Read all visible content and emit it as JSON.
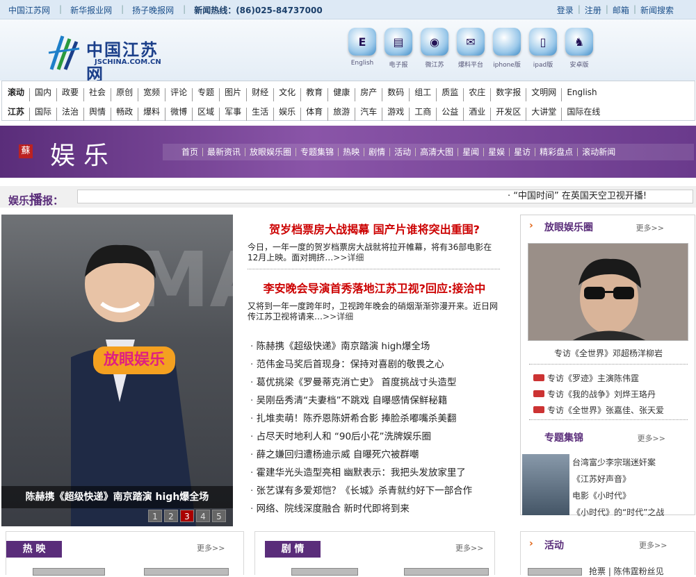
{
  "topbar": {
    "links": [
      "中国江苏网",
      "新华报业网",
      "扬子晚报网"
    ],
    "hotline": "新闻热线：(86)025-84737000",
    "right_links": [
      "登录",
      "注册",
      "邮箱",
      "新闻搜索"
    ]
  },
  "logo": {
    "cn": "中国江苏网",
    "en": "JSCHINA.COM.CN"
  },
  "apps": [
    {
      "icon": "english-app-icon",
      "label": "English",
      "glyph": "E"
    },
    {
      "icon": "epaper-app-icon",
      "label": "电子报",
      "glyph": "▤"
    },
    {
      "icon": "weijiangsu-app-icon",
      "label": "微江苏",
      "glyph": "◉"
    },
    {
      "icon": "baoliao-app-icon",
      "label": "爆料平台",
      "glyph": "✉"
    },
    {
      "icon": "iphone-app-icon",
      "label": "iphone版",
      "glyph": ""
    },
    {
      "icon": "ipad-app-icon",
      "label": "ipad版",
      "glyph": "▯"
    },
    {
      "icon": "android-app-icon",
      "label": "安卓版",
      "glyph": "♞"
    }
  ],
  "nav": {
    "row1": [
      "滚动",
      "国内",
      "政要",
      "社会",
      "原创",
      "宽频",
      "评论",
      "专题",
      "图片",
      "财经",
      "文化",
      "教育",
      "健康",
      "房产",
      "数码",
      "组工",
      "质监",
      "农庄",
      "数字报",
      "文明网",
      "English"
    ],
    "row2": [
      "江苏",
      "国际",
      "法治",
      "舆情",
      "畅政",
      "爆料",
      "微博",
      "区域",
      "军事",
      "生活",
      "娱乐",
      "体育",
      "旅游",
      "汽车",
      "游戏",
      "工商",
      "公益",
      "酒业",
      "开发区",
      "大讲堂",
      "国际在线"
    ]
  },
  "banner": {
    "seal": "蘇",
    "title": "娱乐",
    "nav": [
      "首页",
      "最新资讯",
      "放眼娱乐圈",
      "专题集锦",
      "热映",
      "剧情",
      "活动",
      "高清大图",
      "星闻",
      "星娱",
      "星访",
      "精彩盘点",
      "滚动新闻"
    ]
  },
  "ticker": {
    "label_a": "娱乐",
    "label_b": "播",
    "label_c": "报：",
    "text": "·  “中国时间” 在英国天空卫视开播!"
  },
  "slide": {
    "bg_text": "MA",
    "sign": "放眼娱乐",
    "caption": "陈赫携《超级快递》南京踏演 high爆全场",
    "pages": [
      "1",
      "2",
      "3",
      "4",
      "5"
    ],
    "active_page": "3"
  },
  "headlines": [
    {
      "title": "贺岁档票房大战揭幕 国产片谁将突出重围?",
      "summary": "今日，一年一度的贺岁档票房大战就将拉开帷幕，将有36部电影在12月上映。面对拥挤…",
      "more": ">>详细"
    },
    {
      "title": "李安晚会导演首秀落地江苏卫视?回应:接洽中",
      "summary": "又将到一年一度跨年时，卫视跨年晚会的硝烟渐渐弥漫开来。近日网传江苏卫视将请来…",
      "more": ">>详细"
    }
  ],
  "news_list": [
    "陈赫携《超级快递》南京踏演 high爆全场",
    "范伟金马奖后首现身：保持对喜剧的敬畏之心",
    "葛优挑梁《罗曼蒂克消亡史》 首度挑战寸头造型",
    "吴刚岳秀清“夫妻档”不跳戏 自曝感情保鲜秘籍",
    "扎堆卖萌！陈乔恩陈妍希合影 捧脸杀嘟嘴杀美翻",
    "占尽天时地利人和 “90后小花”洗牌娱乐圈",
    "薛之嫌回归遭杨迪示威 自曝死穴被群嘲",
    "霍建华光头造型亮相 幽默表示：我把头发放家里了",
    "张艺谋有多爱郑恺？《长城》杀青就约好下一部合作",
    "网络、院线深度融合 新时代即将到来"
  ],
  "right": {
    "title": "放眼娱乐圈",
    "more": "更多>>",
    "photo_caption": "专访《全世界》邓超杨洋柳岩",
    "list": [
      "专访《罗迹》主演陈伟霆",
      "专访《我的战争》刘烨王珞丹",
      "专访《全世界》张嘉佳、张天爱"
    ],
    "topic_title": "专题集锦",
    "topic_more": "更多>>",
    "topic_lines": [
      "台湾富少李宗瑞迷奸案",
      "《江苏好声音》",
      "电影《小时代》",
      "《小时代》的“时代”之战"
    ]
  },
  "bottom": {
    "sections": [
      {
        "title": "热 映",
        "more": "更多>>"
      },
      {
        "title": "剧 情",
        "more": "更多>>"
      },
      {
        "title": "活动",
        "more": "更多>>"
      }
    ],
    "activity_snippet": "抢票 | 陈伟霆粉丝见"
  },
  "colors": {
    "brand_purple": "#5a2d7a",
    "headline_red": "#cc0000",
    "topbar_blue": "#1b4f8a"
  }
}
